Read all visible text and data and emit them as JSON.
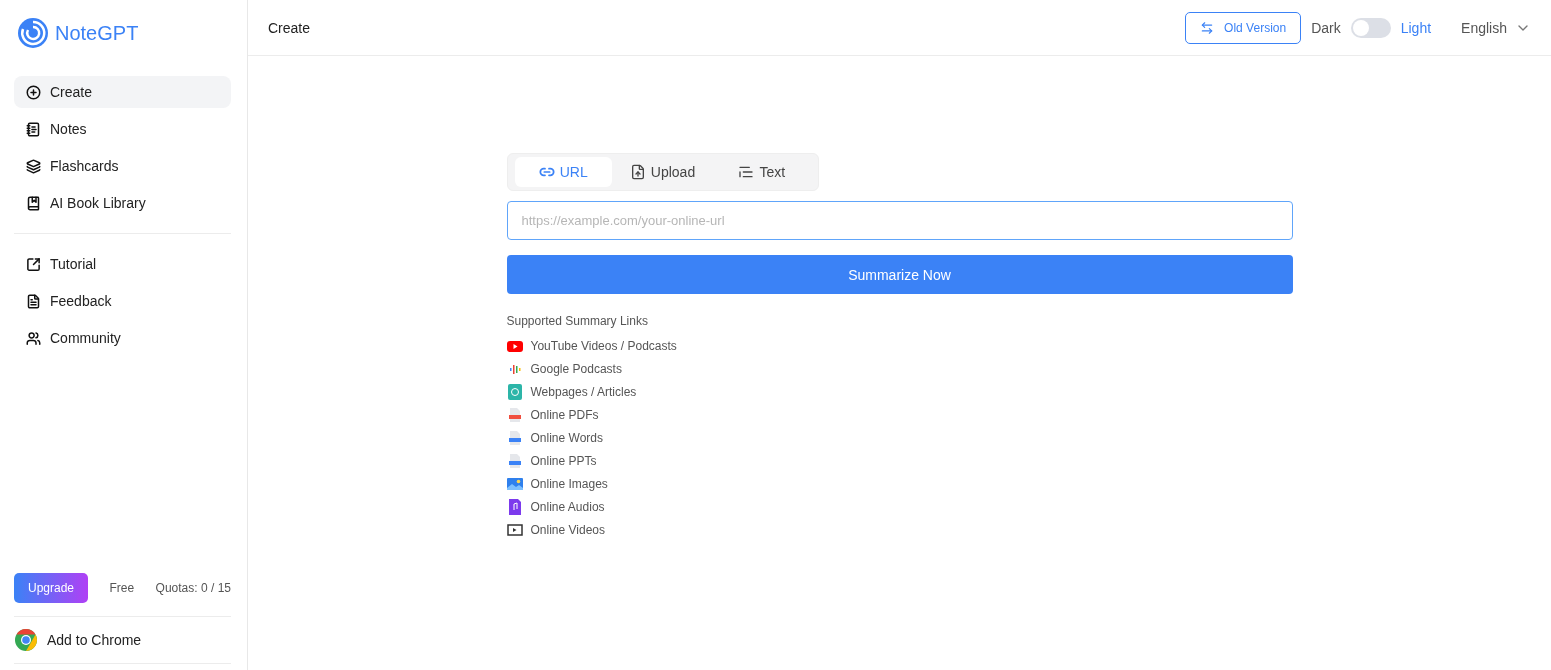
{
  "brand": {
    "name": "NoteGPT"
  },
  "nav": [
    {
      "kind": "create",
      "label": "Create",
      "selected": true
    },
    {
      "kind": "notes",
      "label": "Notes",
      "selected": false
    },
    {
      "kind": "flashcards",
      "label": "Flashcards",
      "selected": false
    },
    {
      "kind": "book",
      "label": "AI Book Library",
      "selected": false
    }
  ],
  "nav_secondary": [
    {
      "kind": "tutorial",
      "label": "Tutorial"
    },
    {
      "kind": "feedback",
      "label": "Feedback"
    },
    {
      "kind": "community",
      "label": "Community"
    }
  ],
  "plan": {
    "button": "Upgrade",
    "tier": "Free",
    "quota": "Quotas: 0 / 15"
  },
  "extension": {
    "label": "Add to Chrome"
  },
  "header": {
    "title": "Create",
    "old_version": "Old Version",
    "dark_label": "Dark",
    "light_label": "Light",
    "dark_mode": false,
    "language": "English"
  },
  "tabs": [
    {
      "kind": "url",
      "label": "URL",
      "selected": true
    },
    {
      "kind": "upload",
      "label": "Upload",
      "selected": false
    },
    {
      "kind": "text",
      "label": "Text",
      "selected": false
    }
  ],
  "input": {
    "placeholder": "https://example.com/your-online-url"
  },
  "submit": "Summarize Now",
  "supported": {
    "title": "Supported Summary Links",
    "items": [
      {
        "kind": "youtube",
        "label": "YouTube Videos / Podcasts"
      },
      {
        "kind": "podcast",
        "label": "Google Podcasts"
      },
      {
        "kind": "web",
        "label": "Webpages / Articles"
      },
      {
        "kind": "pdf",
        "label": "Online PDFs"
      },
      {
        "kind": "word",
        "label": "Online Words"
      },
      {
        "kind": "ppt",
        "label": "Online PPTs"
      },
      {
        "kind": "image",
        "label": "Online Images"
      },
      {
        "kind": "audio",
        "label": "Online Audios"
      },
      {
        "kind": "video",
        "label": "Online Videos"
      }
    ]
  }
}
